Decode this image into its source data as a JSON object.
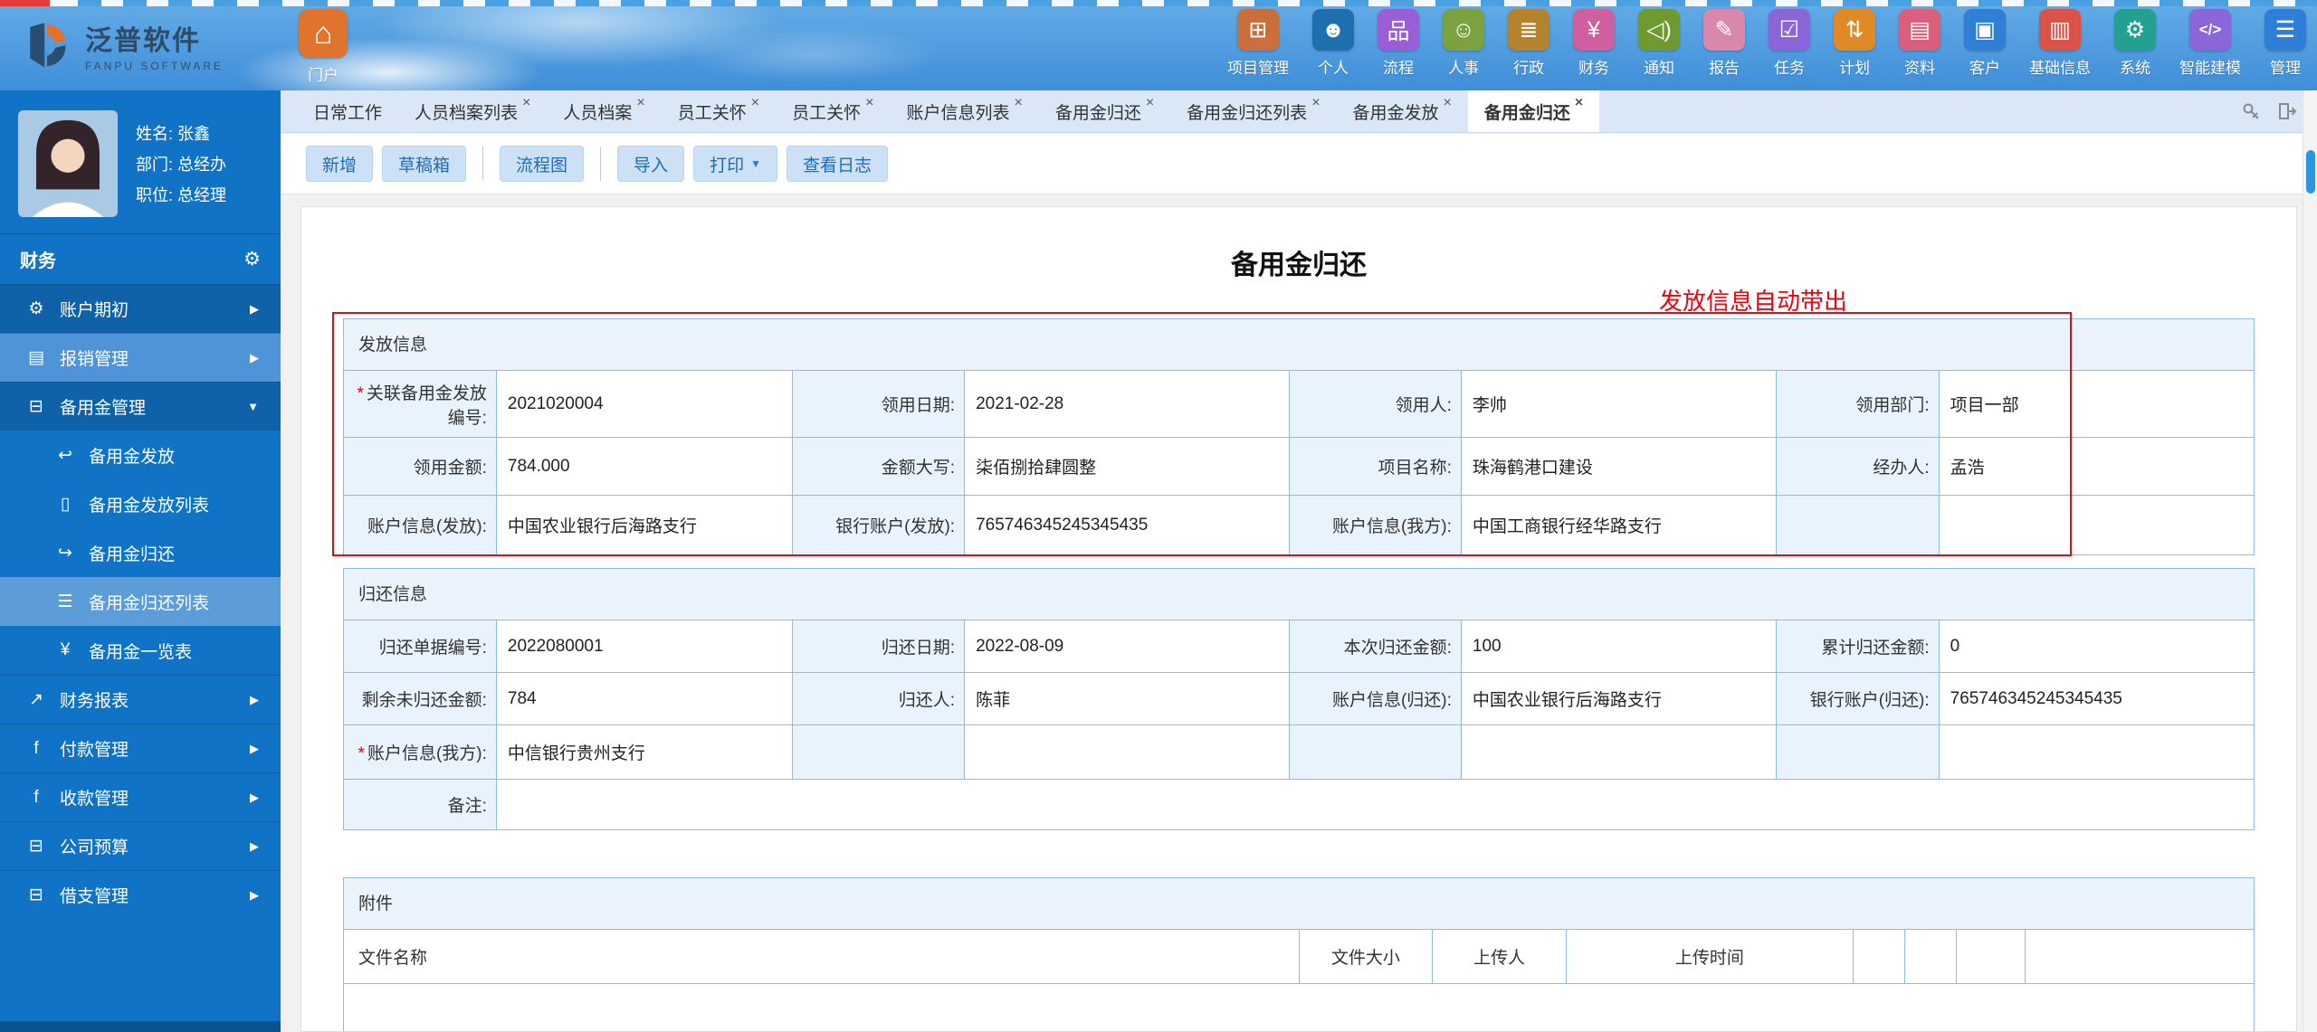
{
  "glyphs": {
    "gear": "⚙",
    "arrow_right": "▶",
    "arrow_down": "▼",
    "close": "×",
    "caret_down": "▼"
  },
  "topbar": {
    "logo": {
      "title": "泛普软件",
      "subtitle": "FANPU SOFTWARE"
    },
    "nav": [
      {
        "id": "portal",
        "label": "门户",
        "glyph": "⌂",
        "color": "#e0742e",
        "large": true
      },
      {
        "id": "project-mgmt",
        "label": "项目管理",
        "glyph": "⊞",
        "color": "#c96f3b"
      },
      {
        "id": "personal",
        "label": "个人",
        "glyph": "☻",
        "color": "#1d6fad"
      },
      {
        "id": "workflow",
        "label": "流程",
        "glyph": "品",
        "color": "#9a5fd6"
      },
      {
        "id": "hr",
        "label": "人事",
        "glyph": "☺",
        "color": "#7ba23f"
      },
      {
        "id": "admin",
        "label": "行政",
        "glyph": "≣",
        "color": "#b5832e"
      },
      {
        "id": "finance",
        "label": "财务",
        "glyph": "¥",
        "color": "#cf5f9f"
      },
      {
        "id": "notice",
        "label": "通知",
        "glyph": "◁)",
        "color": "#6e9a2f"
      },
      {
        "id": "report",
        "label": "报告",
        "glyph": "✎",
        "color": "#d887ad"
      },
      {
        "id": "task",
        "label": "任务",
        "glyph": "☑",
        "color": "#8a66d8"
      },
      {
        "id": "plan",
        "label": "计划",
        "glyph": "⇅",
        "color": "#e08a26"
      },
      {
        "id": "material",
        "label": "资料",
        "glyph": "▤",
        "color": "#d95f7d"
      },
      {
        "id": "customer",
        "label": "客户",
        "glyph": "▣",
        "color": "#2f7fd6"
      },
      {
        "id": "base-info",
        "label": "基础信息",
        "glyph": "▥",
        "color": "#d95348"
      },
      {
        "id": "system",
        "label": "系统",
        "glyph": "⚙",
        "color": "#23a091"
      },
      {
        "id": "smart-modeling",
        "label": "智能建模",
        "glyph": "</>",
        "color": "#8a66d8"
      },
      {
        "id": "manage",
        "label": "管理",
        "glyph": "☰",
        "color": "#2f7fd6"
      }
    ]
  },
  "sidebar": {
    "user": {
      "name_line": "姓名: 张鑫",
      "dept_line": "部门: 总经办",
      "title_line": "职位: 总经理"
    },
    "section_label": "财务",
    "items": [
      {
        "id": "account-initial",
        "label": "账户期初",
        "glyph": "⚙",
        "icon": "gear-icon",
        "style": "dark",
        "top": true,
        "arrow": "right"
      },
      {
        "id": "expense-mgmt",
        "label": "报销管理",
        "glyph": "▤",
        "icon": "idcard-icon",
        "style": "light",
        "top": true,
        "arrow": "right"
      },
      {
        "id": "pettycash-mgmt",
        "label": "备用金管理",
        "glyph": "⊟",
        "icon": "cash-icon",
        "style": "dark",
        "top": true,
        "arrow": "down"
      },
      {
        "id": "pettycash-grant",
        "label": "备用金发放",
        "glyph": "↩",
        "icon": "send-icon",
        "sub": true
      },
      {
        "id": "pettycash-grant-list",
        "label": "备用金发放列表",
        "glyph": "▯",
        "icon": "phone-icon",
        "sub": true
      },
      {
        "id": "pettycash-return",
        "label": "备用金归还",
        "glyph": "↪",
        "icon": "share-icon",
        "sub": true
      },
      {
        "id": "pettycash-return-list",
        "label": "备用金归还列表",
        "glyph": "☰",
        "icon": "list-icon",
        "style": "selected",
        "sub": true
      },
      {
        "id": "pettycash-overview",
        "label": "备用金一览表",
        "glyph": "¥",
        "icon": "yuan-icon",
        "sub": true
      },
      {
        "id": "finance-report",
        "label": "财务报表",
        "glyph": "↗",
        "icon": "chart-icon",
        "top": true,
        "arrow": "right"
      },
      {
        "id": "payment-mgmt",
        "label": "付款管理",
        "glyph": "f",
        "icon": "pay-icon",
        "top": true,
        "arrow": "right"
      },
      {
        "id": "receipt-mgmt",
        "label": "收款管理",
        "glyph": "f",
        "icon": "receive-icon",
        "top": true,
        "arrow": "right"
      },
      {
        "id": "company-budget",
        "label": "公司预算",
        "glyph": "⊟",
        "icon": "budget-icon",
        "top": true,
        "arrow": "right"
      },
      {
        "id": "loan-mgmt",
        "label": "借支管理",
        "glyph": "⊟",
        "icon": "loan-icon",
        "top": true,
        "arrow": "right"
      }
    ]
  },
  "tabs": [
    {
      "id": "daily-work",
      "label": "日常工作",
      "closable": false
    },
    {
      "id": "personnel-file-list",
      "label": "人员档案列表",
      "closable": true
    },
    {
      "id": "personnel-file",
      "label": "人员档案",
      "closable": true
    },
    {
      "id": "employee-care-1",
      "label": "员工关怀",
      "closable": true
    },
    {
      "id": "employee-care-2",
      "label": "员工关怀",
      "closable": true
    },
    {
      "id": "account-info-list",
      "label": "账户信息列表",
      "closable": true
    },
    {
      "id": "pettycash-return-1",
      "label": "备用金归还",
      "closable": true
    },
    {
      "id": "pettycash-return-list",
      "label": "备用金归还列表",
      "closable": true
    },
    {
      "id": "pettycash-grant",
      "label": "备用金发放",
      "closable": true
    },
    {
      "id": "pettycash-return-active",
      "label": "备用金归还",
      "closable": true,
      "active": true
    }
  ],
  "toolbar": [
    {
      "id": "add",
      "label": "新增"
    },
    {
      "id": "draft-box",
      "label": "草稿箱"
    },
    {
      "type": "separator"
    },
    {
      "id": "flow-chart",
      "label": "流程图"
    },
    {
      "type": "separator"
    },
    {
      "id": "import",
      "label": "导入"
    },
    {
      "id": "print",
      "label": "打印",
      "caret": true
    },
    {
      "id": "view-log",
      "label": "查看日志"
    }
  ],
  "form": {
    "title": "备用金归还",
    "annotation": "发放信息自动带出",
    "sections": {
      "grant": {
        "id": "grant",
        "title": "发放信息",
        "rows": [
          [
            {
              "label": "关联备用金发放编号:",
              "required": true,
              "value": "2021020004"
            },
            {
              "label": "领用日期:",
              "value": "2021-02-28"
            },
            {
              "label": "领用人:",
              "value": "李帅"
            },
            {
              "label": "领用部门:",
              "value": "项目一部"
            }
          ],
          [
            {
              "label": "领用金额:",
              "value": "784.000"
            },
            {
              "label": "金额大写:",
              "value": "柒佰捌拾肆圆整"
            },
            {
              "label": "项目名称:",
              "value": "珠海鹤港口建设"
            },
            {
              "label": "经办人:",
              "value": "孟浩"
            }
          ],
          [
            {
              "label": "账户信息(发放):",
              "value": "中国农业银行后海路支行"
            },
            {
              "label": "银行账户(发放):",
              "value": "765746345245345435"
            },
            {
              "label": "账户信息(我方):",
              "value": "中国工商银行经华路支行"
            },
            {
              "label": "",
              "value": ""
            }
          ]
        ]
      },
      "return": {
        "id": "return",
        "title": "归还信息",
        "rows": [
          [
            {
              "label": "归还单据编号:",
              "value": "2022080001"
            },
            {
              "label": "归还日期:",
              "value": "2022-08-09"
            },
            {
              "label": "本次归还金额:",
              "value": "100"
            },
            {
              "label": "累计归还金额:",
              "value": "0"
            }
          ],
          [
            {
              "label": "剩余未归还金额:",
              "value": "784"
            },
            {
              "label": "归还人:",
              "value": "陈菲"
            },
            {
              "label": "账户信息(归还):",
              "value": "中国农业银行后海路支行"
            },
            {
              "label": "银行账户(归还):",
              "value": "765746345245345435"
            }
          ],
          [
            {
              "label": "账户信息(我方):",
              "required": true,
              "value": "中信银行贵州支行"
            },
            {
              "label": "",
              "value": ""
            },
            {
              "label": "",
              "value": ""
            },
            {
              "label": "",
              "value": ""
            }
          ],
          [
            {
              "label": "备注:",
              "value": "",
              "span": 7
            }
          ]
        ]
      },
      "attachment": {
        "id": "attachment",
        "title": "附件",
        "headers": [
          "文件名称",
          "文件大小",
          "上传人",
          "上传时间",
          "",
          "",
          "",
          ""
        ]
      }
    }
  }
}
